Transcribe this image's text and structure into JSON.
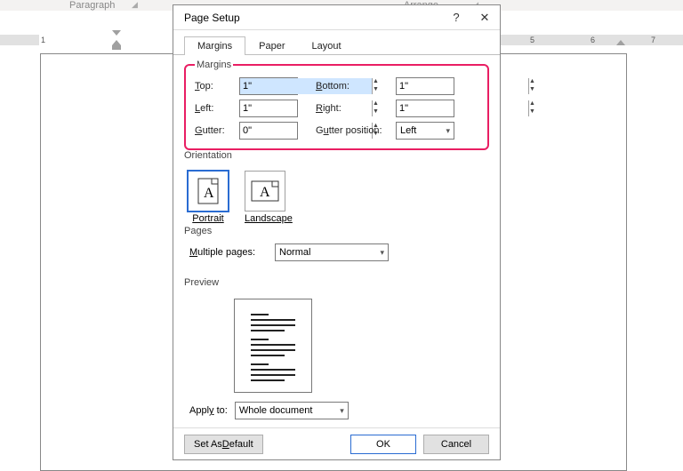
{
  "ribbon": {
    "label_paragraph": "Paragraph",
    "label_arrange": "Arrange"
  },
  "ruler": {
    "ticks": [
      "1",
      "5",
      "6",
      "7"
    ]
  },
  "dialog": {
    "title": "Page Setup",
    "tabs": {
      "margins": "Margins",
      "paper": "Paper",
      "layout": "Layout"
    },
    "margins_group": {
      "legend": "Margins",
      "top_label": "Top:",
      "top_value": "1\"",
      "bottom_label": "Bottom:",
      "bottom_value": "1\"",
      "left_label": "Left:",
      "left_value": "1\"",
      "right_label": "Right:",
      "right_value": "1\"",
      "gutter_label": "Gutter:",
      "gutter_value": "0\"",
      "gutter_pos_label": "Gutter position:",
      "gutter_pos_value": "Left"
    },
    "orientation": {
      "legend": "Orientation",
      "portrait": "Portrait",
      "landscape": "Landscape"
    },
    "pages": {
      "legend": "Pages",
      "multi_label": "Multiple pages:",
      "multi_value": "Normal"
    },
    "preview": {
      "legend": "Preview"
    },
    "apply": {
      "label": "Apply to:",
      "value": "Whole document"
    },
    "buttons": {
      "default": "Set As Default",
      "ok": "OK",
      "cancel": "Cancel"
    }
  }
}
